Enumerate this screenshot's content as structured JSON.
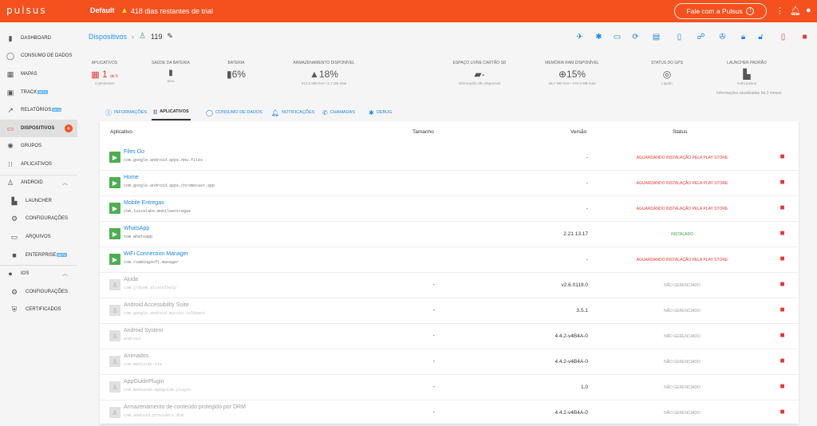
{
  "topbar": {
    "logo": "pulsus",
    "account": "Default",
    "trial_text": "418 dias restantes de trial",
    "talk_button": "Fale com a Pulsus"
  },
  "sidebar": {
    "items": [
      {
        "label": "DASHBOARD",
        "icon": "bar-chart-icon"
      },
      {
        "label": "CONSUMO DE DADOS",
        "icon": "donut-icon"
      },
      {
        "label": "MAPAS",
        "icon": "map-icon"
      },
      {
        "label": "TRACK",
        "badge": "BETA",
        "icon": "track-icon"
      },
      {
        "label": "RELATÓRIOS",
        "badge": "BETA",
        "icon": "trend-icon"
      },
      {
        "label": "DISPOSITIVOS",
        "icon": "devices-icon"
      },
      {
        "label": "GRUPOS",
        "icon": "groups-icon"
      },
      {
        "label": "APLICATIVOS",
        "icon": "apps-icon"
      },
      {
        "label": "ANDROID",
        "icon": "android-icon"
      },
      {
        "label": "LAUNCHER",
        "icon": "launcher-icon"
      },
      {
        "label": "CONFIGURAÇÕES",
        "icon": "gear-icon"
      },
      {
        "label": "ARQUIVOS",
        "icon": "folder-icon"
      },
      {
        "label": "ENTERPRISE",
        "badge": "BETA",
        "icon": "briefcase-icon"
      },
      {
        "label": "IOS",
        "icon": "apple-icon"
      },
      {
        "label": "CONFIGURAÇÕES",
        "icon": "gear-icon"
      },
      {
        "label": "CERTIFICADOS",
        "icon": "shield-icon"
      }
    ]
  },
  "breadcrumb": {
    "link": "Dispositivos",
    "device_id": "119"
  },
  "stats": [
    {
      "label": "APLICATIVOS",
      "value": "1",
      "suffix": "de 5",
      "sub": "4 pendentes"
    },
    {
      "label": "SAÚDE DA BATERIA",
      "value": "",
      "sub": "Boa"
    },
    {
      "label": "BATERIA",
      "value": "6%",
      "sub": ""
    },
    {
      "label": "ARMAZENAMENTO DISPONÍVEL",
      "value": "18%",
      "sub": "513,6 MB livre / 2,7 GB total"
    },
    {
      "label": "ESPAÇO LIVRE CARTÃO SD",
      "value": "-",
      "sub": "Informação não disponível"
    },
    {
      "label": "MEMÓRIA RAM DISPONÍVEL",
      "value": "15%",
      "sub": "68,7 MB livre / 470,9 MB total"
    },
    {
      "label": "STATUS DO GPS",
      "value": "",
      "sub": "Ligado"
    },
    {
      "label": "LAUNCHER PADRÃO",
      "value": "",
      "sub": "mobi.pulsus"
    }
  ],
  "updated_text": "Informações atualizadas há 3 meses",
  "tabs": [
    {
      "label": "INFORMAÇÕES"
    },
    {
      "label": "APLICATIVOS"
    },
    {
      "label": "CONSUMO DE DADOS"
    },
    {
      "label": "NOTIFICAÇÕES"
    },
    {
      "label": "CHAMADAS"
    },
    {
      "label": "DEBUG"
    }
  ],
  "table": {
    "headers": {
      "app": "Aplicativo",
      "size": "Tamanho",
      "version": "Versão",
      "status": "Status"
    },
    "rows": [
      {
        "name": "Files Go",
        "pkg": "com.google.android.apps.nbu.files",
        "size": "",
        "version": "-",
        "status": "AGUARDANDO INSTALAÇÃO PELA PLAY STORE"
      },
      {
        "name": "Home",
        "pkg": "com.google.android.apps.chromecast.app",
        "size": "",
        "version": "-",
        "status": "AGUARDANDO INSTALAÇÃO PELA PLAY STORE"
      },
      {
        "name": "Mobile Entregas",
        "pkg": "com.luizalabs.mobileentregas",
        "size": "",
        "version": "-",
        "status": "AGUARDANDO INSTALAÇÃO PELA PLAY STORE"
      },
      {
        "name": "WhatsApp",
        "pkg": "com.whatsapp",
        "size": "",
        "version": "2.21.13.17",
        "status": "INSTALADO"
      },
      {
        "name": "WiFi Connection Manager",
        "pkg": "com.roamingsoft.manager",
        "size": "",
        "version": "-",
        "status": "AGUARDANDO INSTALAÇÃO PELA PLAY STORE"
      },
      {
        "name": "Ajuda",
        "pkg": "com.jrdcom.alcatelhelp",
        "size": "-",
        "version": "v2.6.0119.0",
        "status": "NÃO GERENCIADO"
      },
      {
        "name": "Android Accessibility Suite",
        "pkg": "com.google.android.marvin.talkback",
        "size": "-",
        "version": "3.5.1",
        "status": "NÃO GERENCIADO"
      },
      {
        "name": "Android System",
        "pkg": "android",
        "size": "-",
        "version": "4.4.2-v4B4A-0",
        "status": "NÃO GERENCIADO"
      },
      {
        "name": "Animados",
        "pkg": "com.mediatek.vlw",
        "size": "-",
        "version": "4.4.2-v4B4A-0",
        "status": "NÃO GERENCIADO"
      },
      {
        "name": "AppGuidePlugin",
        "pkg": "com.mediatek.appguide.plugin",
        "size": "-",
        "version": "1.0",
        "status": "NÃO GERENCIADO"
      },
      {
        "name": "Armazenamento de conteúdo protegido por DRM",
        "pkg": "com.android.providers.drm",
        "size": "-",
        "version": "4.4.2-v4B4A-0",
        "status": "NÃO GERENCIADO"
      }
    ]
  },
  "colors": {
    "brand": "#f4511e",
    "link": "#1e88e5",
    "danger": "#e53935",
    "success": "#43a047"
  }
}
